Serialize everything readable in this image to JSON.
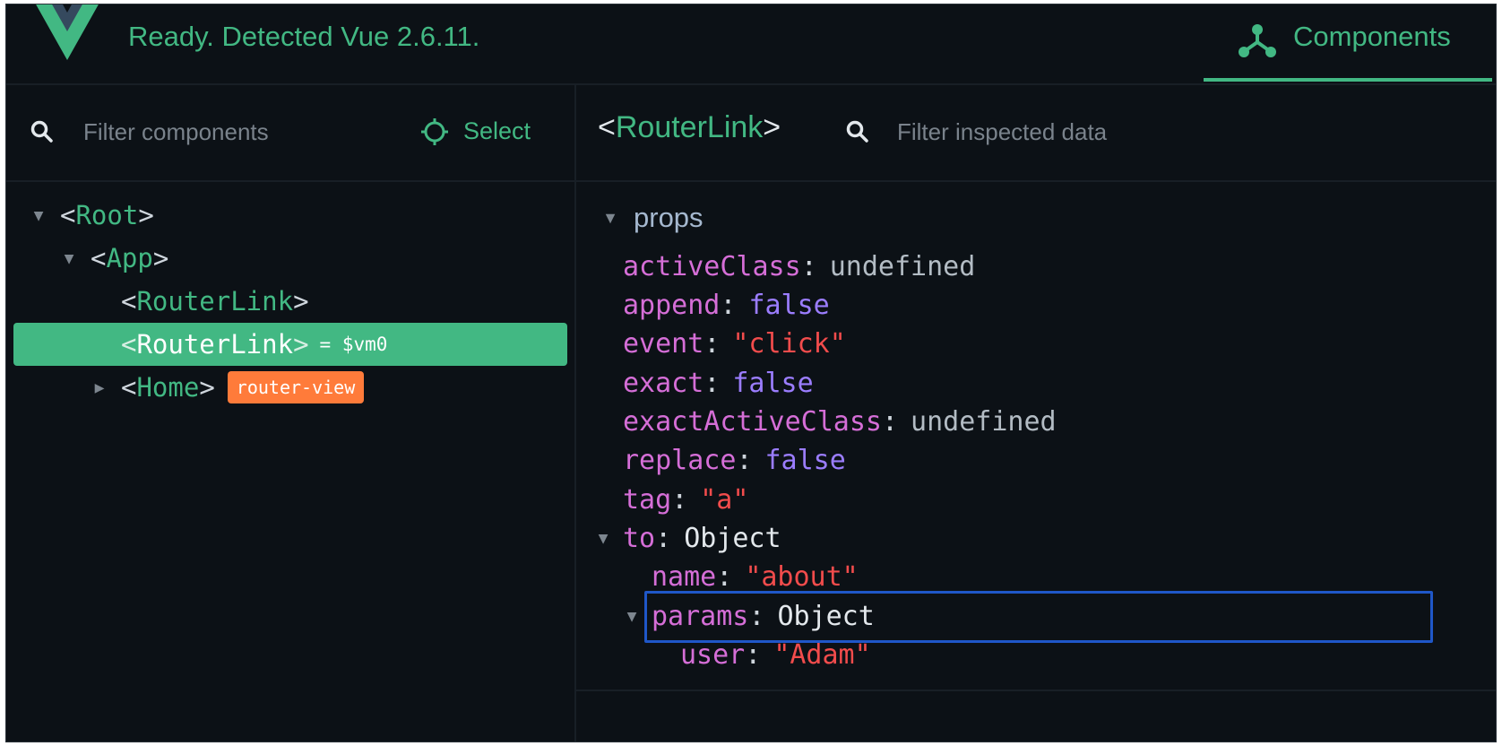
{
  "header": {
    "status": "Ready. Detected Vue 2.6.11.",
    "tab_label": "Components",
    "colors": {
      "accent": "#42b883",
      "background": "#0c1116"
    }
  },
  "tree_panel": {
    "filter_placeholder": "Filter components",
    "select_label": "Select",
    "nodes": [
      {
        "name": "Root",
        "expanded": true
      },
      {
        "name": "App",
        "expanded": true
      },
      {
        "name": "RouterLink"
      },
      {
        "name": "RouterLink",
        "vm": "= $vm0",
        "selected": true
      },
      {
        "name": "Home",
        "expanded": false,
        "badge": "router-view"
      }
    ]
  },
  "inspector": {
    "component": "RouterLink",
    "filter_placeholder": "Filter inspected data",
    "section": "props",
    "props": [
      {
        "key": "activeClass",
        "value": "undefined",
        "type": "undefined"
      },
      {
        "key": "append",
        "value": "false",
        "type": "boolean"
      },
      {
        "key": "event",
        "value": "\"click\"",
        "type": "string"
      },
      {
        "key": "exact",
        "value": "false",
        "type": "boolean"
      },
      {
        "key": "exactActiveClass",
        "value": "undefined",
        "type": "undefined"
      },
      {
        "key": "replace",
        "value": "false",
        "type": "boolean"
      },
      {
        "key": "tag",
        "value": "\"a\"",
        "type": "string"
      },
      {
        "key": "to",
        "value": "Object",
        "type": "object"
      },
      {
        "key": "name",
        "value": "\"about\"",
        "type": "string"
      },
      {
        "key": "params",
        "value": "Object",
        "type": "object"
      },
      {
        "key": "user",
        "value": "\"Adam\"",
        "type": "string"
      }
    ]
  }
}
